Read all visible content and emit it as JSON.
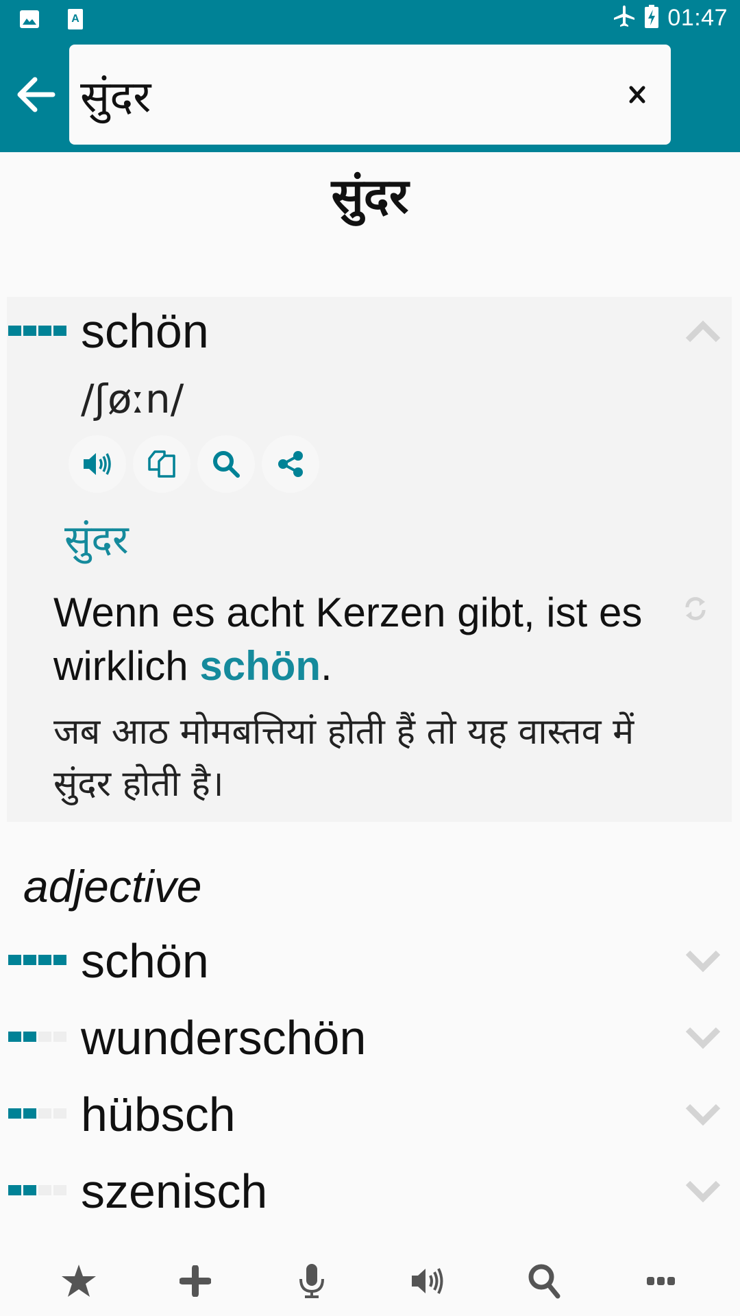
{
  "status_bar": {
    "time": "01:47",
    "left_icons": [
      "image-icon",
      "text-a-icon"
    ],
    "right_icons": [
      "airplane-mode-icon",
      "battery-charging-icon"
    ]
  },
  "search": {
    "value": "सुंदर",
    "placeholder": "",
    "clear_label": "×"
  },
  "entry": {
    "headword": "सुंदर"
  },
  "expanded_card": {
    "word": "schön",
    "frequency": 4,
    "frequency_max": 4,
    "ipa": "/ʃøːn/",
    "actions": [
      "speaker-icon",
      "copy-icon",
      "search-icon",
      "share-icon"
    ],
    "translation": "सुंदर",
    "example_de_before": "Wenn es acht Kerzen gibt, ist es wirklich ",
    "example_de_highlight": "schön",
    "example_de_after": ".",
    "example_hi": "जब आठ मोमबत्तियां होती हैं तो यह वास्तव में सुंदर होती है।"
  },
  "part_of_speech": "adjective",
  "translations": [
    {
      "word": "schön",
      "frequency": 4
    },
    {
      "word": "wunderschön",
      "frequency": 2
    },
    {
      "word": "hübsch",
      "frequency": 2
    },
    {
      "word": "szenisch",
      "frequency": 2
    }
  ],
  "bottom_bar": [
    "star-icon",
    "plus-icon",
    "microphone-icon",
    "speaker-icon",
    "search-icon",
    "more-icon"
  ],
  "colors": {
    "accent": "#008296",
    "highlight_text": "#158a9c",
    "chevron": "#d4d4d4",
    "bottom_icons": "#555555"
  }
}
